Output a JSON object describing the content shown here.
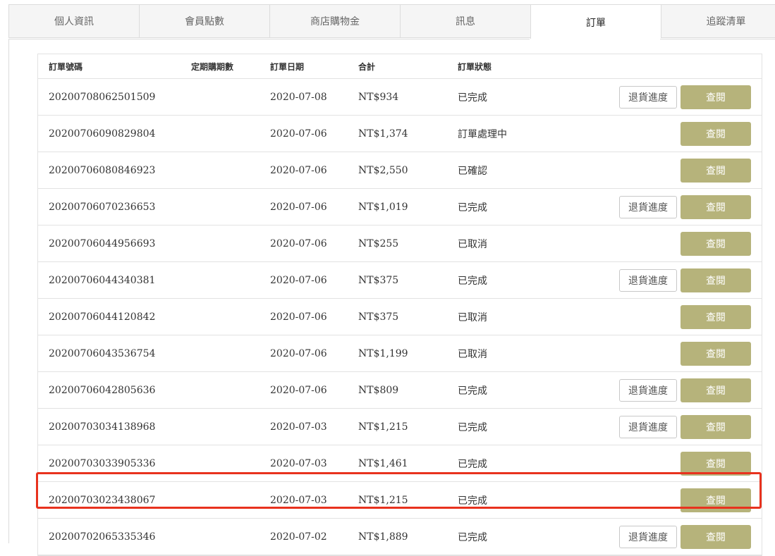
{
  "tabs": [
    {
      "label": "個人資訊"
    },
    {
      "label": "會員點數"
    },
    {
      "label": "商店購物金"
    },
    {
      "label": "訊息"
    },
    {
      "label": "訂單"
    },
    {
      "label": "追蹤清單"
    }
  ],
  "active_tab": "訂單",
  "table": {
    "headers": {
      "order_no": "訂單號碼",
      "subscription": "定期購期數",
      "date": "訂單日期",
      "total": "合計",
      "status": "訂單狀態"
    },
    "return_label": "退貨進度",
    "view_label": "查閱",
    "rows": [
      {
        "order_no": "20200708062501509",
        "date": "2020-07-08",
        "total": "NT$934",
        "status": "已完成",
        "has_return": true
      },
      {
        "order_no": "20200706090829804",
        "date": "2020-07-06",
        "total": "NT$1,374",
        "status": "訂單處理中",
        "has_return": false
      },
      {
        "order_no": "20200706080846923",
        "date": "2020-07-06",
        "total": "NT$2,550",
        "status": "已確認",
        "has_return": false
      },
      {
        "order_no": "20200706070236653",
        "date": "2020-07-06",
        "total": "NT$1,019",
        "status": "已完成",
        "has_return": true
      },
      {
        "order_no": "20200706044956693",
        "date": "2020-07-06",
        "total": "NT$255",
        "status": "已取消",
        "has_return": false
      },
      {
        "order_no": "20200706044340381",
        "date": "2020-07-06",
        "total": "NT$375",
        "status": "已完成",
        "has_return": true
      },
      {
        "order_no": "20200706044120842",
        "date": "2020-07-06",
        "total": "NT$375",
        "status": "已取消",
        "has_return": false
      },
      {
        "order_no": "20200706043536754",
        "date": "2020-07-06",
        "total": "NT$1,199",
        "status": "已取消",
        "has_return": false
      },
      {
        "order_no": "20200706042805636",
        "date": "2020-07-06",
        "total": "NT$809",
        "status": "已完成",
        "has_return": true
      },
      {
        "order_no": "20200703034138968",
        "date": "2020-07-03",
        "total": "NT$1,215",
        "status": "已完成",
        "has_return": true
      },
      {
        "order_no": "20200703033905336",
        "date": "2020-07-03",
        "total": "NT$1,461",
        "status": "已完成",
        "has_return": false
      },
      {
        "order_no": "20200703023438067",
        "date": "2020-07-03",
        "total": "NT$1,215",
        "status": "已完成",
        "has_return": false
      },
      {
        "order_no": "20200702065335346",
        "date": "2020-07-02",
        "total": "NT$1,889",
        "status": "已完成",
        "has_return": true
      }
    ]
  },
  "colors": {
    "view_button": "#b6b37b",
    "highlight": "#e8321e"
  }
}
